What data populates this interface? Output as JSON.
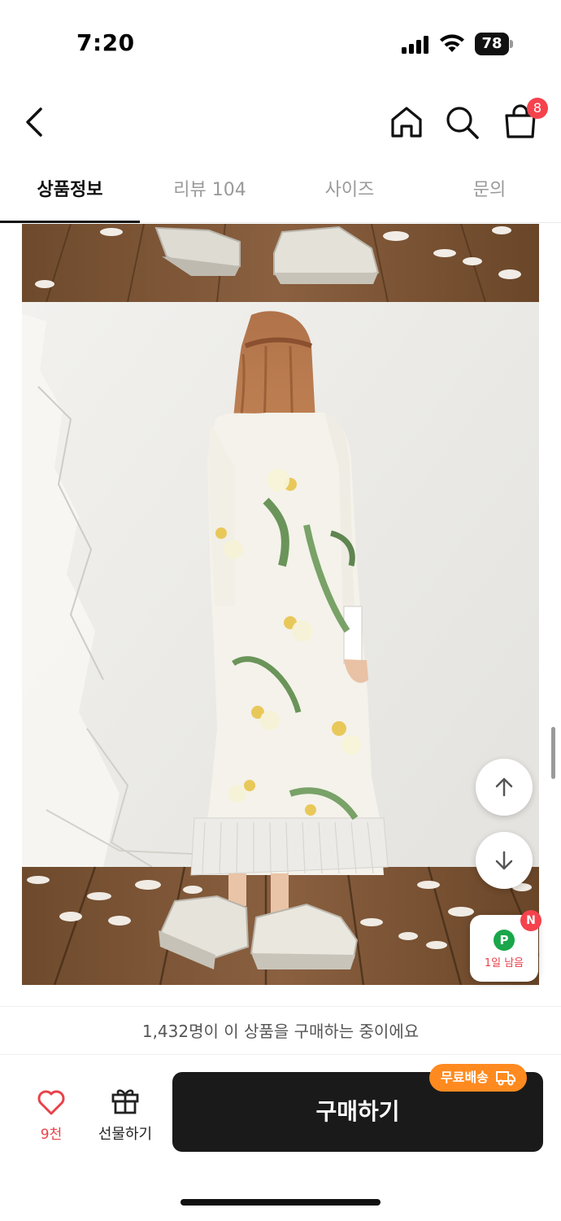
{
  "status_bar": {
    "time": "7:20",
    "battery": "78",
    "icons": [
      "signal-icon",
      "wifi-icon",
      "battery-icon"
    ]
  },
  "header": {
    "icons": [
      "back-arrow-icon",
      "home-icon",
      "search-icon",
      "shopping-bag-icon"
    ],
    "cart_badge": "8"
  },
  "tabs": [
    {
      "label": "상품정보",
      "active": true
    },
    {
      "label": "리뷰 104",
      "active": false
    },
    {
      "label": "사이즈",
      "active": false
    },
    {
      "label": "문의",
      "active": false
    }
  ],
  "floating": {
    "scroll_up_icon": "arrow-up-icon",
    "scroll_down_icon": "arrow-down-icon",
    "point_letter": "P",
    "point_label": "1일 남음",
    "new_badge": "N"
  },
  "buyers_banner": "1,432명이 이 상품을 구매하는 중이에요",
  "action_bar": {
    "like_count": "9천",
    "gift_label": "선물하기",
    "buy_label": "구매하기",
    "free_shipping": "무료배송"
  },
  "colors": {
    "accent_red": "#f5424d",
    "buy_button": "#1a1a1a",
    "free_shipping": "#ff8a1f",
    "point_green": "#1aa64a"
  }
}
